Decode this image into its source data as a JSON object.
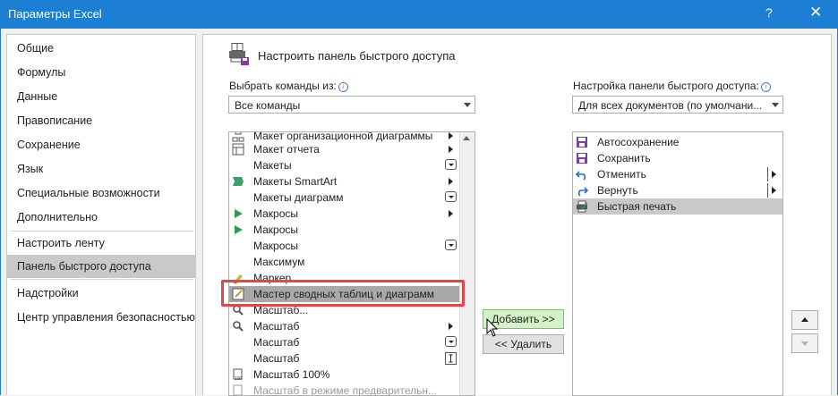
{
  "window": {
    "title": "Параметры Excel",
    "help": "?",
    "close": "✕"
  },
  "nav": {
    "items": [
      {
        "label": "Общие"
      },
      {
        "label": "Формулы"
      },
      {
        "label": "Данные"
      },
      {
        "label": "Правописание"
      },
      {
        "label": "Сохранение"
      },
      {
        "label": "Язык"
      },
      {
        "label": "Специальные возможности"
      },
      {
        "label": "Дополнительно"
      },
      {
        "label": "Настроить ленту"
      },
      {
        "label": "Панель быстрого доступа",
        "selected": true
      },
      {
        "label": "Надстройки"
      },
      {
        "label": "Центр управления безопасностью"
      }
    ]
  },
  "header": {
    "title": "Настроить панель быстрого доступа",
    "icon": "quick-access-toolbar-icon"
  },
  "choose": {
    "label": "Выбрать команды из:",
    "value": "Все команды",
    "info_glyph": "i"
  },
  "customize": {
    "label": "Настройка панели быстрого доступа:",
    "value": "Для всех документов (по умолчани...",
    "info_glyph": "i"
  },
  "commands": [
    {
      "label": "Макет организационной диаграммы",
      "icon": "org-chart-icon",
      "suffix": "submenu"
    },
    {
      "label": "Макет отчета",
      "icon": "report-layout-icon",
      "suffix": "submenu"
    },
    {
      "label": "Макеты",
      "icon": "",
      "suffix": "dropdown"
    },
    {
      "label": "Макеты SmartArt",
      "icon": "smartart-icon",
      "suffix": "submenu"
    },
    {
      "label": "Макеты диаграмм",
      "icon": "",
      "suffix": "dropdown"
    },
    {
      "label": "Макросы",
      "icon": "macro-play-icon",
      "suffix": "submenu"
    },
    {
      "label": "Макросы",
      "icon": "macro-play-icon",
      "suffix": ""
    },
    {
      "label": "Макросы",
      "icon": "",
      "suffix": "dropdown"
    },
    {
      "label": "Максимум",
      "icon": "",
      "suffix": ""
    },
    {
      "label": "Маркер",
      "icon": "marker-icon",
      "suffix": ""
    },
    {
      "label": "Мастер сводных таблиц и диаграмм",
      "icon": "pivot-wizard-icon",
      "suffix": "",
      "selected": true
    },
    {
      "label": "Масштаб...",
      "icon": "zoom-icon",
      "suffix": ""
    },
    {
      "label": "Масштаб",
      "icon": "zoom-icon",
      "suffix": "submenu"
    },
    {
      "label": "Масштаб",
      "icon": "",
      "suffix": "dropdown"
    },
    {
      "label": "Масштаб",
      "icon": "",
      "suffix": "textbox"
    },
    {
      "label": "Масштаб 100%",
      "icon": "zoom-100-icon",
      "suffix": ""
    },
    {
      "label": "Масштаб в режиме предварительн...",
      "icon": "zoom-preview-icon",
      "suffix": ""
    }
  ],
  "toolbar_items": [
    {
      "label": "Автосохранение",
      "icon": "autosave-icon",
      "suffix": ""
    },
    {
      "label": "Сохранить",
      "icon": "save-icon",
      "suffix": ""
    },
    {
      "label": "Отменить",
      "icon": "undo-icon",
      "suffix": "submenu"
    },
    {
      "label": "Вернуть",
      "icon": "redo-icon",
      "suffix": "submenu"
    },
    {
      "label": "Быстрая печать",
      "icon": "quick-print-icon",
      "suffix": "",
      "selected": true
    }
  ],
  "buttons": {
    "add": "Добавить >>",
    "remove": "<< Удалить"
  },
  "colors": {
    "titlebar": "#1c7fd3",
    "selection": "#c9c9c9",
    "highlight_border": "#e04848",
    "add_button": "#d4f1c9"
  }
}
